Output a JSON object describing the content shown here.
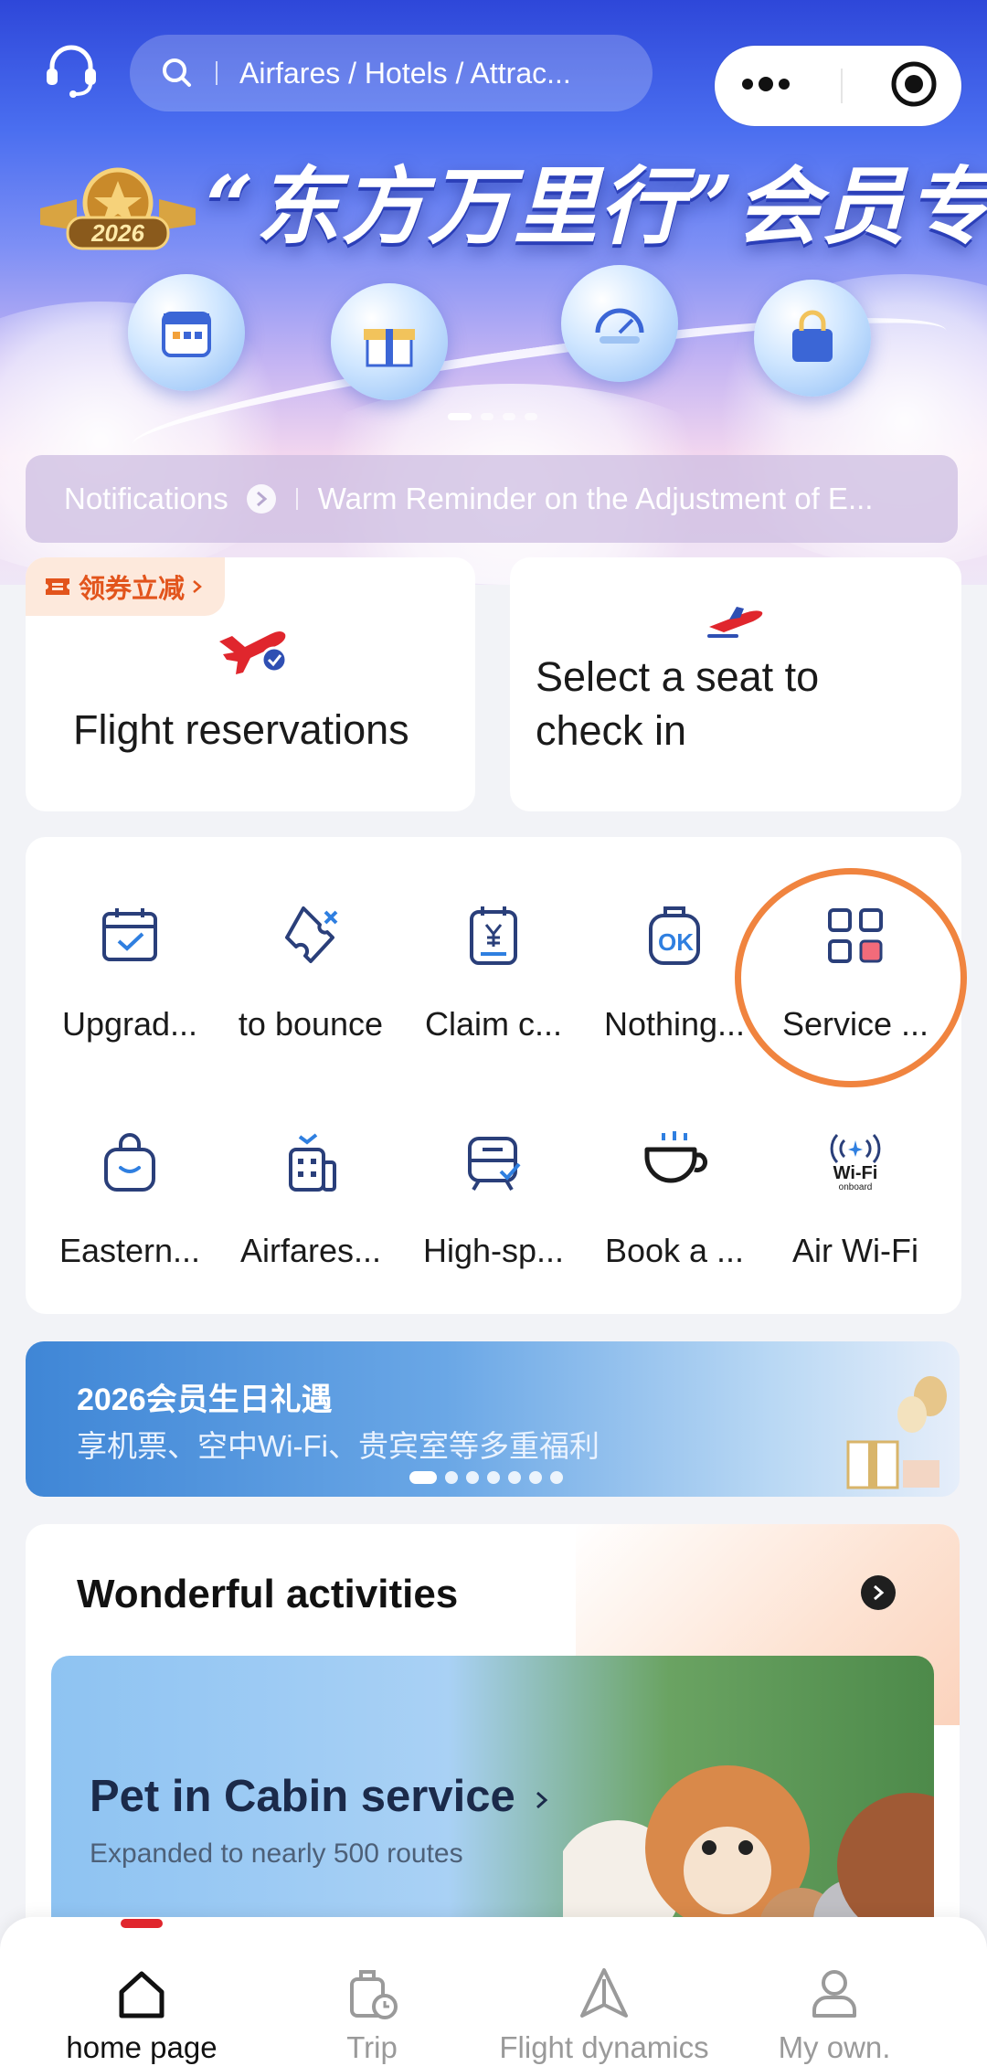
{
  "header": {
    "search_placeholder": "Airfares / Hotels / Attrac...",
    "hero_title": "“东方万里行”会员专区",
    "badge_year": "2026",
    "support_icon": "headset-icon",
    "capsule_icons": [
      "more-dots-icon",
      "close-target-icon"
    ]
  },
  "notice": {
    "label": "Notifications",
    "message": "Warm Reminder on the Adjustment of E..."
  },
  "main_cards": {
    "flight": {
      "coupon": "领券立减",
      "label": "Flight reservations"
    },
    "checkin": {
      "label_line1": "Select a seat to",
      "label_line2": "check in"
    }
  },
  "services": [
    {
      "label": "Upgrad...",
      "icon": "calendar-check-icon"
    },
    {
      "label": "to bounce",
      "icon": "ticket-cancel-icon"
    },
    {
      "label": "Claim c...",
      "icon": "yen-receipt-icon"
    },
    {
      "label": "Nothing...",
      "icon": "luggage-ok-icon"
    },
    {
      "label": "Service ...",
      "icon": "grid-apps-icon"
    },
    {
      "label": "Eastern...",
      "icon": "shopping-bag-icon"
    },
    {
      "label": "Airfares...",
      "icon": "hotel-building-icon"
    },
    {
      "label": "High-sp...",
      "icon": "train-check-icon"
    },
    {
      "label": "Book a ...",
      "icon": "coffee-cup-icon"
    },
    {
      "label": "Air Wi-Fi",
      "icon": "wifi-onboard-icon"
    }
  ],
  "wifi_icon_text": {
    "main": "Wi-Fi",
    "sub": "onboard"
  },
  "promo": {
    "title": "2026会员生日礼遇",
    "subtitle": "享机票、空中Wi-Fi、贵宾室等多重福利"
  },
  "activities": {
    "title": "Wonderful activities",
    "pet_title": "Pet in Cabin service",
    "pet_subtitle": "Expanded to nearly 500 routes"
  },
  "tabs": [
    {
      "label": "home page",
      "icon": "home-icon",
      "active": true
    },
    {
      "label": "Trip",
      "icon": "suitcase-clock-icon",
      "active": false
    },
    {
      "label": "Flight dynamics",
      "icon": "plane-arrow-icon",
      "active": false
    },
    {
      "label": "My own.",
      "icon": "user-icon",
      "active": false
    }
  ],
  "colors": {
    "accent_red": "#e0262d",
    "highlight_ring": "#f0843f",
    "hero_blue": "#2e47d9"
  }
}
